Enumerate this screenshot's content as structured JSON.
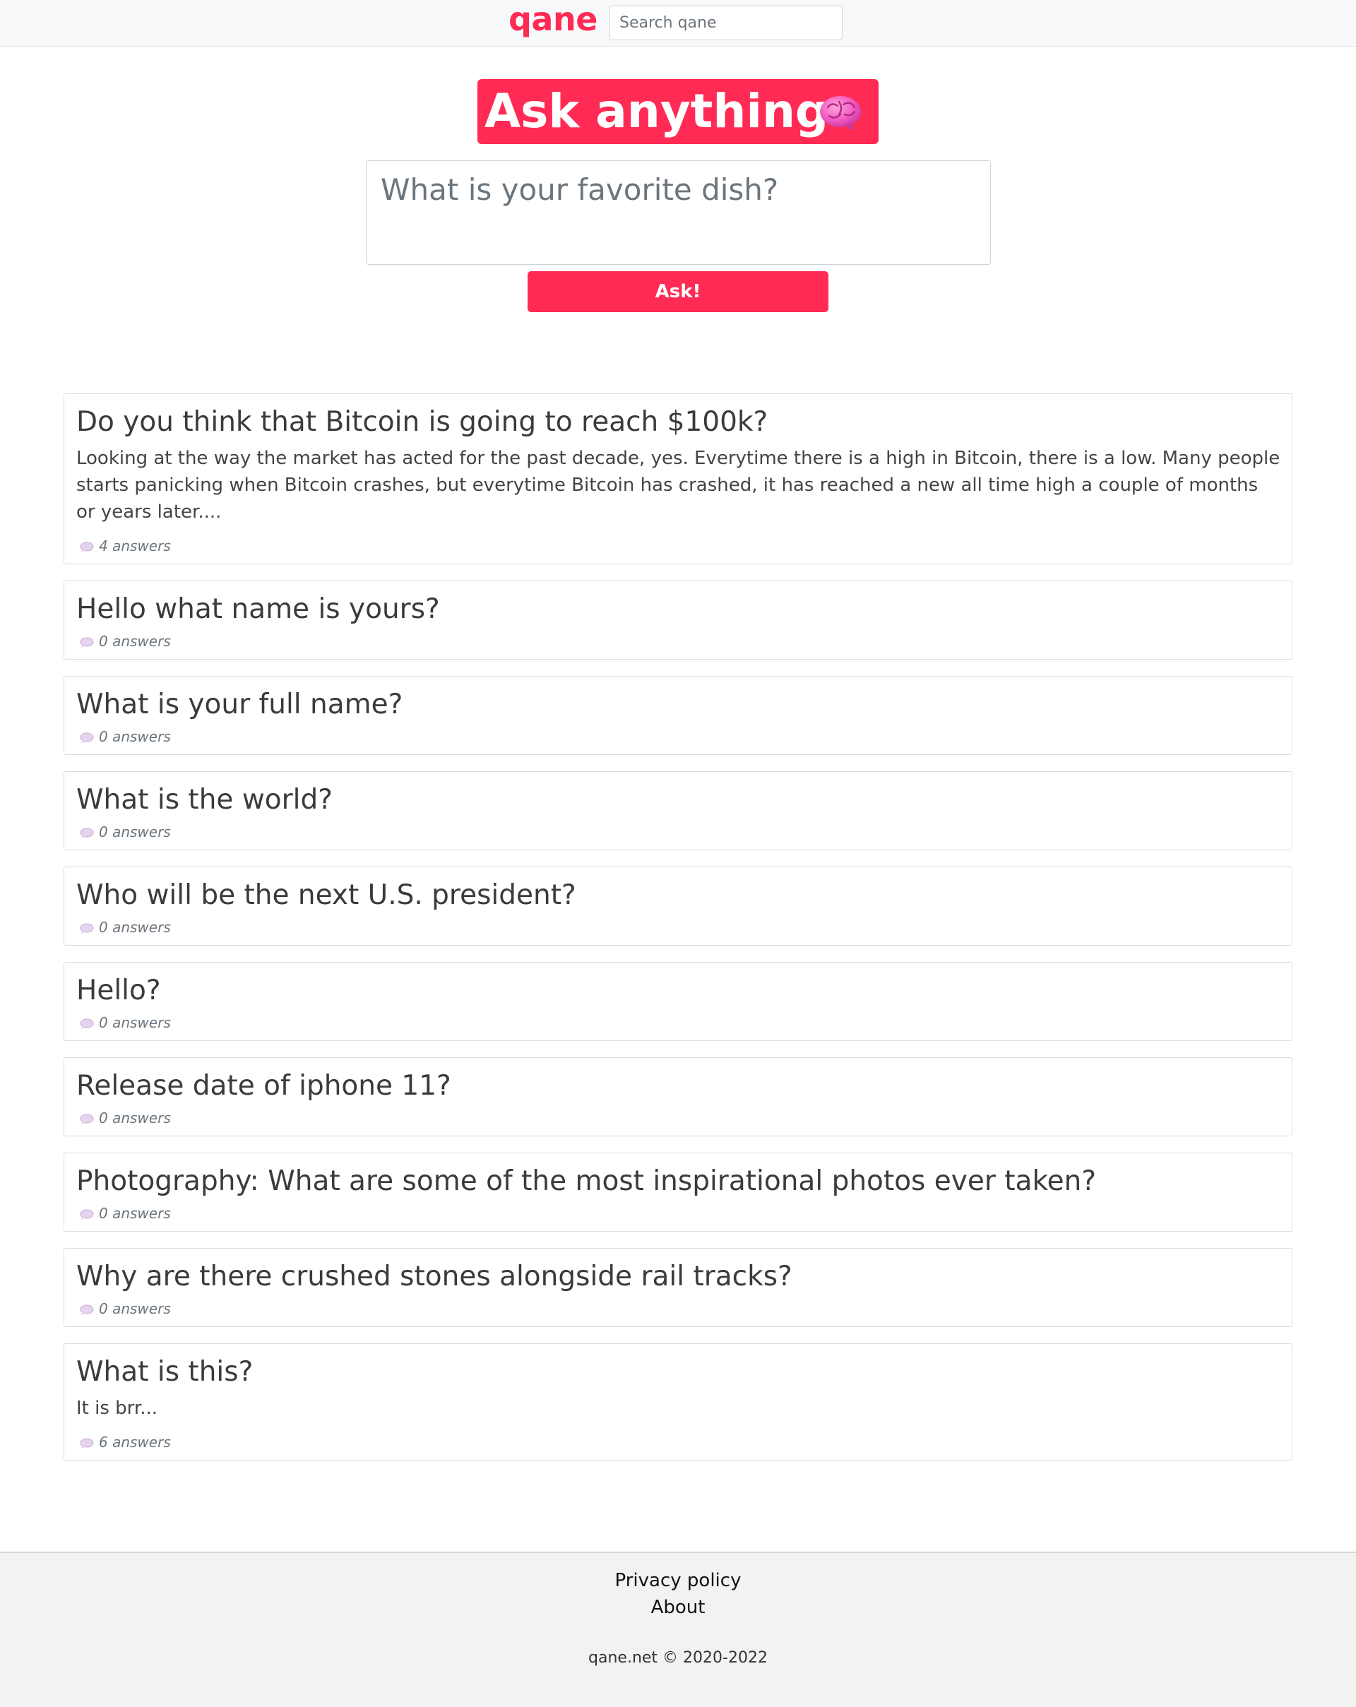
{
  "header": {
    "brand": "qane",
    "search_placeholder": "Search qane"
  },
  "hero": {
    "title": "Ask anything",
    "title_icon": "brain-emoji",
    "question_placeholder": "What is your favorite dish?",
    "ask_button": "Ask!"
  },
  "questions": [
    {
      "title": "Do you think that Bitcoin is going to reach $100k?",
      "excerpt": "Looking at the way the market has acted for the past decade, yes. Everytime there is a high in Bitcoin, there is a low. Many people starts panicking when Bitcoin crashes, but everytime Bitcoin has crashed, it has reached a new all time high a couple of months or years later....",
      "answers": "4 answers"
    },
    {
      "title": "Hello what name is yours?",
      "answers": "0 answers"
    },
    {
      "title": "What is your full name?",
      "answers": "0 answers"
    },
    {
      "title": "What is the world?",
      "answers": "0 answers"
    },
    {
      "title": "Who will be the next U.S. president?",
      "answers": "0 answers"
    },
    {
      "title": "Hello?",
      "answers": "0 answers"
    },
    {
      "title": "Release date of iphone 11?",
      "answers": "0 answers"
    },
    {
      "title": "Photography: What are some of the most inspirational photos ever taken?",
      "answers": "0 answers"
    },
    {
      "title": "Why are there crushed stones alongside rail tracks?",
      "answers": "0 answers"
    },
    {
      "title": "What is this?",
      "excerpt": "It is brr...",
      "answers": "6 answers"
    }
  ],
  "footer": {
    "privacy": "Privacy policy",
    "about": "About",
    "copyright": "qane.net © 2020-2022"
  },
  "colors": {
    "accent": "#ff2b55",
    "topbar_bg": "#f8f9fa",
    "footer_bg": "#f2f2f2",
    "card_border": "#dcdcdc"
  }
}
